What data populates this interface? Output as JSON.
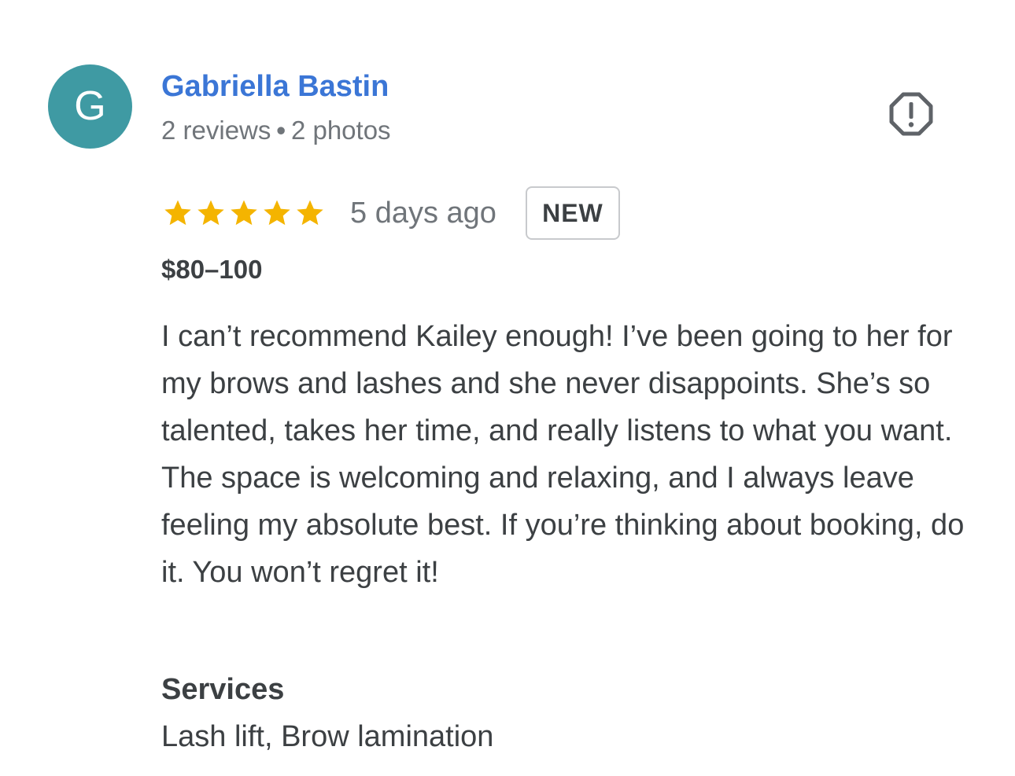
{
  "review": {
    "author": {
      "initial": "G",
      "avatar_color": "#3f9aa3",
      "name": "Gabriella Bastin",
      "name_color": "#3b76d6",
      "reviews_count": "2 reviews",
      "separator": "•",
      "photos_count": "2 photos"
    },
    "report_icon": "report-octagon-icon",
    "rating": {
      "stars": 5,
      "max_stars": 5,
      "star_icon": "star-icon",
      "star_color": "#f4b400"
    },
    "date": "5 days ago",
    "badge": "NEW",
    "price_range": "$80–100",
    "text": "I can’t recommend Kailey enough! I’ve been going to her for my brows and lashes and she never disappoints. She’s so talented, takes her time, and really listens to what you want. The space is welcoming and relaxing, and I always leave feeling my absolute best. If you’re thinking about booking, do it. You won’t regret it!",
    "services": {
      "heading": "Services",
      "list": "Lash lift, Brow lamination"
    }
  }
}
